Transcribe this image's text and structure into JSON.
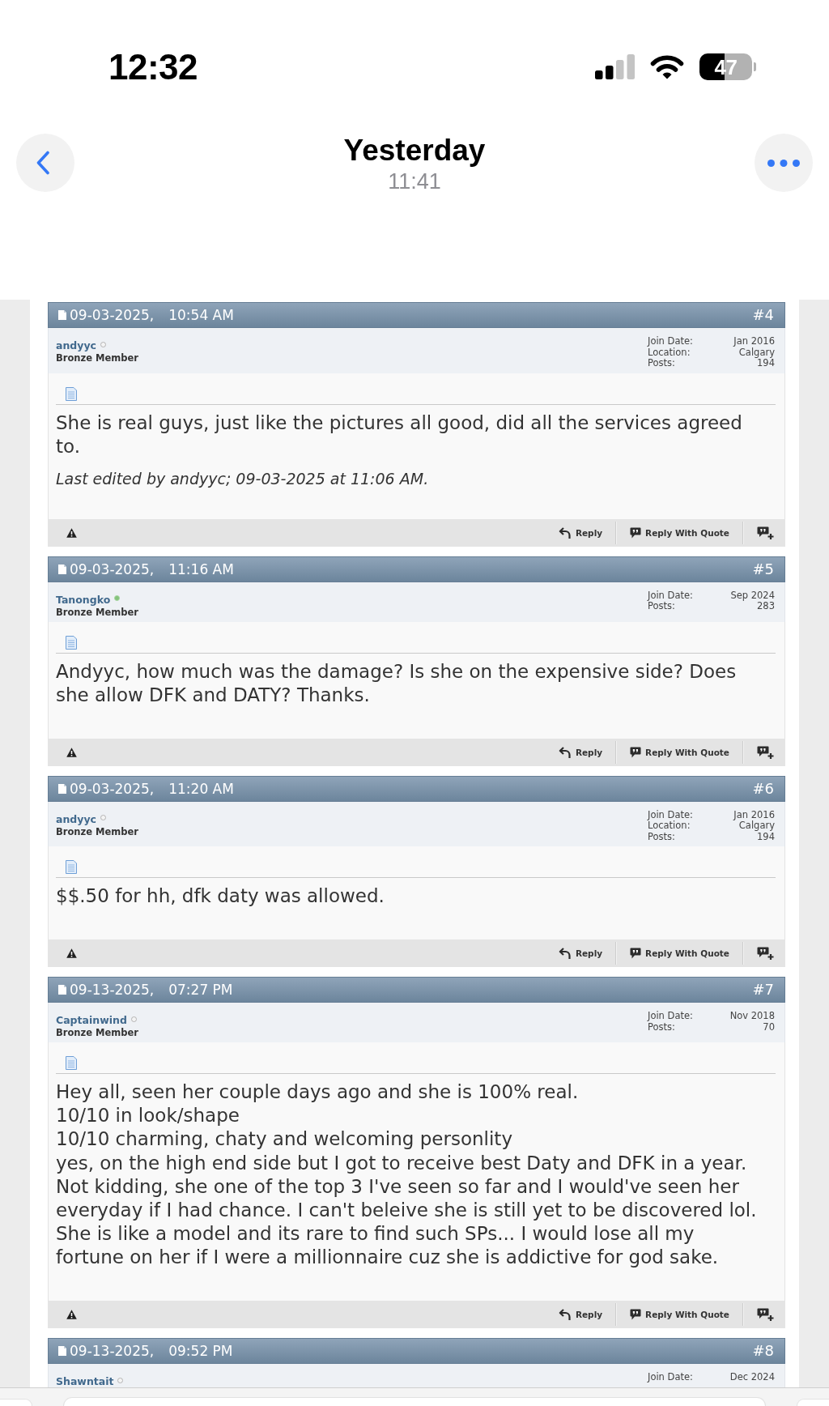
{
  "status_bar": {
    "time": "12:32",
    "battery": "47"
  },
  "nav": {
    "title": "Yesterday",
    "subtitle": "11:41"
  },
  "posts": [
    {
      "date": "09-03-2025,",
      "time": "10:54 AM",
      "number": "#4",
      "user": {
        "name": "andyyc",
        "online": false,
        "rank": "Bronze Member"
      },
      "info": [
        {
          "label": "Join Date:",
          "value": "Jan 2016"
        },
        {
          "label": "Location:",
          "value": "Calgary"
        },
        {
          "label": "Posts:",
          "value": "194"
        }
      ],
      "body": "She is real guys, just like the pictures all good, did all the services agreed\nto.",
      "edit_note": "Last edited by andyyc; 09-03-2025 at 11:06 AM.",
      "footer": {
        "reply": "Reply",
        "quote": "Reply With Quote"
      }
    },
    {
      "date": "09-03-2025,",
      "time": "11:16 AM",
      "number": "#5",
      "user": {
        "name": "Tanongko",
        "online": true,
        "rank": "Bronze Member"
      },
      "info": [
        {
          "label": "Join Date:",
          "value": "Sep 2024"
        },
        {
          "label": "Posts:",
          "value": "283"
        }
      ],
      "body": "Andyyc, how much was the damage? Is she on the expensive side? Does\nshe allow DFK and DATY? Thanks.",
      "footer": {
        "reply": "Reply",
        "quote": "Reply With Quote"
      }
    },
    {
      "date": "09-03-2025,",
      "time": "11:20 AM",
      "number": "#6",
      "user": {
        "name": "andyyc",
        "online": false,
        "rank": "Bronze Member"
      },
      "info": [
        {
          "label": "Join Date:",
          "value": "Jan 2016"
        },
        {
          "label": "Location:",
          "value": "Calgary"
        },
        {
          "label": "Posts:",
          "value": "194"
        }
      ],
      "body": "$$.50 for hh, dfk daty was allowed.",
      "footer": {
        "reply": "Reply",
        "quote": "Reply With Quote"
      }
    },
    {
      "date": "09-13-2025,",
      "time": "07:27 PM",
      "number": "#7",
      "user": {
        "name": "Captainwind",
        "online": false,
        "rank": "Bronze Member"
      },
      "info": [
        {
          "label": "Join Date:",
          "value": "Nov 2018"
        },
        {
          "label": "Posts:",
          "value": "70"
        }
      ],
      "body": "Hey all, seen her couple days ago and she is 100% real.\n10/10 in look/shape\n10/10 charming, chaty and welcoming personlity\nyes, on the high end side but I got to receive best Daty and DFK in a year.\nNot kidding, she one of the top 3 I've seen so far and I would've seen her\neveryday if I had chance. I can't beleive she is still yet to be discovered lol.\nShe is like a model and its rare to find such SPs... I would lose all my\nfortune on her if I were a millionnaire cuz she is addictive for god sake.",
      "footer": {
        "reply": "Reply",
        "quote": "Reply With Quote"
      }
    },
    {
      "date": "09-13-2025,",
      "time": "09:52 PM",
      "number": "#8",
      "user": {
        "name": "Shawntait",
        "online": false
      },
      "info": [
        {
          "label": "Join Date:",
          "value": "Dec 2024"
        }
      ]
    }
  ]
}
